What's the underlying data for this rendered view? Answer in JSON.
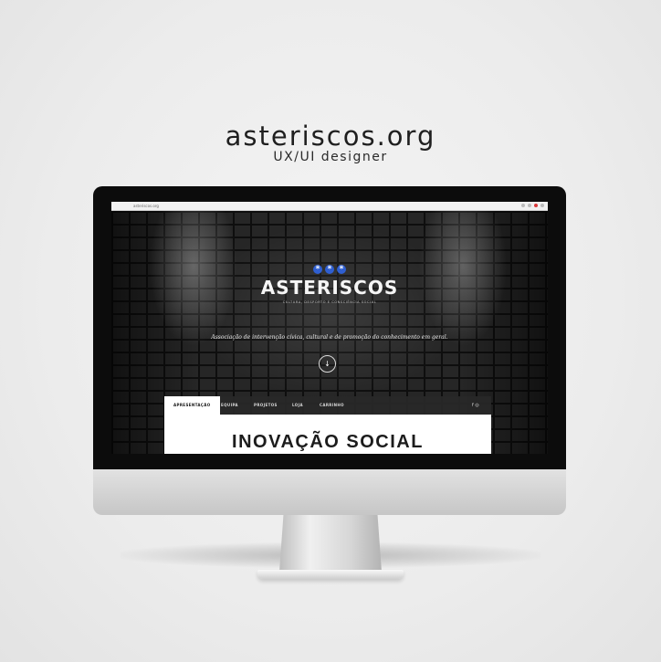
{
  "page": {
    "title": "asteriscos.org",
    "subtitle": "UX/UI designer"
  },
  "browser": {
    "url": "asteriscos.org"
  },
  "website": {
    "logo_icons": [
      "asterisk-icon",
      "asterisk-icon",
      "asterisk-icon"
    ],
    "logo_name": "ASTERISCOS",
    "logo_tagline": "CULTURA, DESPORTO E CONSCIÊNCIA SOCIAL",
    "description": "Associação de intervenção cívica, cultural e de promoção do conhecimento em geral.",
    "nav": {
      "items": [
        {
          "label": "APRESENTAÇÃO",
          "active": true
        },
        {
          "label": "EQUIPA",
          "active": false
        },
        {
          "label": "PROJETOS",
          "active": false
        },
        {
          "label": "LOJA",
          "active": false
        },
        {
          "label": "CARRINHO",
          "active": false
        }
      ],
      "social": [
        "facebook-icon",
        "instagram-icon"
      ]
    },
    "section_heading": "INOVAÇÃO SOCIAL"
  },
  "colors": {
    "brand_blue": "#2f5fd1",
    "browser_red": "#d9383a"
  }
}
